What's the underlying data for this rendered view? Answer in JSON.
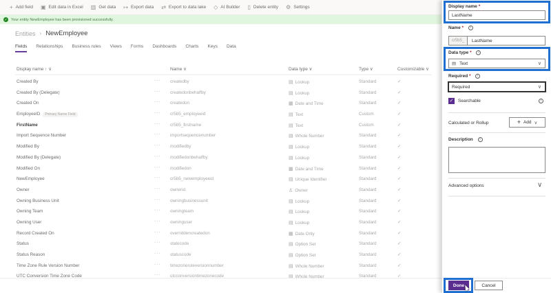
{
  "toolbar": {
    "items": [
      {
        "icon": "plus-icon",
        "label": "Add field"
      },
      {
        "icon": "excel-icon",
        "label": "Edit data in Excel"
      },
      {
        "icon": "database-icon",
        "label": "Get data"
      },
      {
        "icon": "export-icon",
        "label": "Export data"
      },
      {
        "icon": "datalake-icon",
        "label": "Export to data lake"
      },
      {
        "icon": "ai-builder-icon",
        "label": "AI Builder"
      },
      {
        "icon": "trash-icon",
        "label": "Delete entity"
      },
      {
        "icon": "gear-icon",
        "label": "Settings"
      }
    ]
  },
  "notice": {
    "text": "Your entity NewEmployee has been provisioned successfully."
  },
  "breadcrumb": {
    "parent": "Entities",
    "separator": "›",
    "current": "NewEmployee"
  },
  "tabs": [
    "Fields",
    "Relationships",
    "Business rules",
    "Views",
    "Forms",
    "Dashboards",
    "Charts",
    "Keys",
    "Data"
  ],
  "table": {
    "headers": {
      "display_name": "Display name ↑ ∨",
      "name": "Name ∨",
      "data_type": "Data type ∨",
      "type": "Type ∨",
      "customizable": "Customizable ∨"
    },
    "more_label": "···",
    "rows": [
      {
        "display": "Created By",
        "name": "createdby",
        "dt_icon": "▤",
        "data_type": "Lookup",
        "type": "Standard",
        "cust": "✓"
      },
      {
        "display": "Created By (Delegate)",
        "name": "createdonbehalfby",
        "dt_icon": "▤",
        "data_type": "Lookup",
        "type": "Standard",
        "cust": "✓"
      },
      {
        "display": "Created On",
        "name": "createdon",
        "dt_icon": "▦",
        "data_type": "Date and Time",
        "type": "Standard",
        "cust": "✓"
      },
      {
        "display": "EmployeeID",
        "pill": "Primary Name Field",
        "name": "cr5b5_employeeid",
        "dt_icon": "▤",
        "data_type": "Text",
        "type": "Custom",
        "cust": "✓"
      },
      {
        "display": "FirstName",
        "name": "cr5b5_firstname",
        "dt_icon": "▤",
        "data_type": "Text",
        "type": "Custom",
        "cust": "✓"
      },
      {
        "display": "Import Sequence Number",
        "name": "importsequencenumber",
        "dt_icon": "▤",
        "data_type": "Whole Number",
        "type": "Standard",
        "cust": "✓"
      },
      {
        "display": "Modified By",
        "name": "modifiedby",
        "dt_icon": "▤",
        "data_type": "Lookup",
        "type": "Standard",
        "cust": "✓"
      },
      {
        "display": "Modified By (Delegate)",
        "name": "modifiedonbehalfby",
        "dt_icon": "▤",
        "data_type": "Lookup",
        "type": "Standard",
        "cust": "✓"
      },
      {
        "display": "Modified On",
        "name": "modifiedon",
        "dt_icon": "▦",
        "data_type": "Date and Time",
        "type": "Standard",
        "cust": "✓"
      },
      {
        "display": "NewEmployee",
        "name": "cr5b5_newemployeeid",
        "dt_icon": "▤",
        "data_type": "Unique Identifier",
        "type": "Standard",
        "cust": "✓"
      },
      {
        "display": "Owner",
        "name": "ownerid",
        "dt_icon": "♙",
        "data_type": "Owner",
        "type": "Standard",
        "cust": "✓"
      },
      {
        "display": "Owning Business Unit",
        "name": "owningbusinessunit",
        "dt_icon": "▤",
        "data_type": "Lookup",
        "type": "Standard",
        "cust": "✓"
      },
      {
        "display": "Owning Team",
        "name": "owningteam",
        "dt_icon": "▤",
        "data_type": "Lookup",
        "type": "Standard",
        "cust": "✓"
      },
      {
        "display": "Owning User",
        "name": "owninguser",
        "dt_icon": "▤",
        "data_type": "Lookup",
        "type": "Standard",
        "cust": "✓"
      },
      {
        "display": "Record Created On",
        "name": "overriddencreatedon",
        "dt_icon": "▦",
        "data_type": "Date Only",
        "type": "Standard",
        "cust": "✓"
      },
      {
        "display": "Status",
        "name": "statecode",
        "dt_icon": "▤",
        "data_type": "Option Set",
        "type": "Standard",
        "cust": "✓"
      },
      {
        "display": "Status Reason",
        "name": "statuscode",
        "dt_icon": "▤",
        "data_type": "Option Set",
        "type": "Standard",
        "cust": "✓"
      },
      {
        "display": "Time Zone Rule Version Number",
        "name": "timezoneruleversionnumber",
        "dt_icon": "▤",
        "data_type": "Whole Number",
        "type": "Standard",
        "cust": "✓"
      },
      {
        "display": "UTC Conversion Time Zone Code",
        "name": "utcconversiontimezonecode",
        "dt_icon": "▤",
        "data_type": "Whole Number",
        "type": "Standard",
        "cust": "✓"
      }
    ]
  },
  "panel": {
    "display_name_label": "Display name",
    "display_name_value": "LastName",
    "name_label": "Name",
    "name_prefix": "cr5b5_",
    "name_value": "LastName",
    "data_type_label": "Data type",
    "data_type_icon": "▤",
    "data_type_value": "Text",
    "required_label": "Required",
    "required_value": "Required",
    "searchable_label": "Searchable",
    "calc_label": "Calculated or Rollup",
    "add_label": "Add",
    "description_label": "Description",
    "advanced_label": "Advanced options",
    "done_label": "Done",
    "cancel_label": "Cancel",
    "required_star": "*",
    "info_glyph": "i",
    "chevron_down": "∨",
    "check_glyph": "✓",
    "plus_glyph": "+"
  },
  "colors": {
    "accent": "#5c2d91",
    "highlight": "#1f6fd1",
    "success_bg": "#dff6dd"
  }
}
